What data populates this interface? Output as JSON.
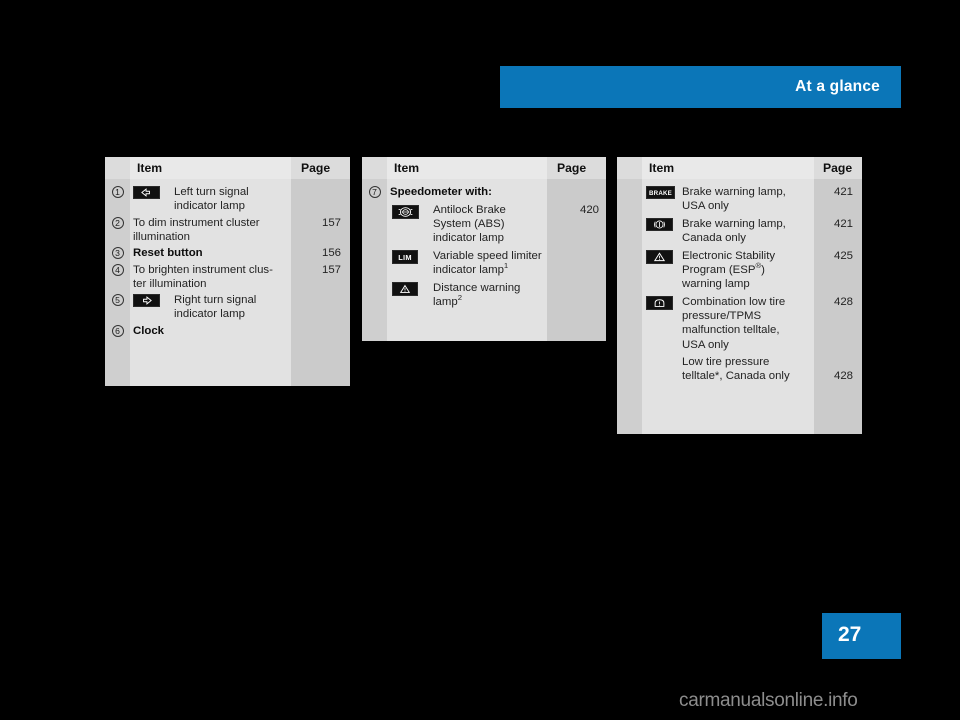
{
  "header": {
    "title": "At a glance",
    "bar_color": "#0b76b8"
  },
  "footer": {
    "page_number": "27",
    "watermark": "carmanualsonline.info"
  },
  "tables": [
    {
      "id": "table-instrument-cluster",
      "columns": {
        "item": "Item",
        "page": "Page"
      },
      "rows": [
        {
          "num": "1",
          "icon": "left-turn-signal-icon",
          "text": "Left turn signal indicator lamp",
          "page": "",
          "bold": false
        },
        {
          "num": "2",
          "icon": "",
          "text": "To dim instrument cluster illumination",
          "page": "157",
          "bold": false
        },
        {
          "num": "3",
          "icon": "",
          "text": "Reset button",
          "page": "156",
          "bold": true
        },
        {
          "num": "4",
          "icon": "",
          "text": "To brighten instrument clus-ter illumination",
          "page": "157",
          "bold": false
        },
        {
          "num": "5",
          "icon": "right-turn-signal-icon",
          "text": "Right turn signal indicator lamp",
          "page": "",
          "bold": false
        },
        {
          "num": "6",
          "icon": "",
          "text": "Clock",
          "page": "",
          "bold": true
        }
      ]
    },
    {
      "id": "table-speedometer",
      "columns": {
        "item": "Item",
        "page": "Page"
      },
      "rows": [
        {
          "num": "7",
          "icon": "",
          "text": "Speedometer with:",
          "page": "",
          "bold": true
        },
        {
          "num": "",
          "icon": "abs-icon",
          "text": "Antilock Brake System (ABS) indicator lamp",
          "page": "420",
          "bold": false
        },
        {
          "num": "",
          "icon": "lim-icon",
          "text": "Variable speed limiter indicator lamp",
          "sup": "1",
          "page": "",
          "bold": false
        },
        {
          "num": "",
          "icon": "distance-warning-icon",
          "text": "Distance warning lamp",
          "sup": "2",
          "page": "",
          "bold": false
        }
      ]
    },
    {
      "id": "table-warning-lamps",
      "columns": {
        "item": "Item",
        "page": "Page"
      },
      "rows": [
        {
          "num": "",
          "icon": "brake-text-icon",
          "text": "Brake warning lamp, USA only",
          "page": "421",
          "bold": false
        },
        {
          "num": "",
          "icon": "brake-circle-icon",
          "text": "Brake warning lamp, Canada only",
          "page": "421",
          "bold": false
        },
        {
          "num": "",
          "icon": "esp-triangle-icon",
          "text": "Electronic Stability Program (ESP®) warning lamp",
          "page": "425",
          "bold": false
        },
        {
          "num": "",
          "icon": "tire-pressure-icon",
          "text": "Combination low tire pressure/TPMS malfunction telltale, USA only",
          "page": "428",
          "bold": false
        },
        {
          "num": "",
          "icon": "",
          "text": "Low tire pressure telltale*, Canada only",
          "page": "428",
          "bold": false
        }
      ]
    }
  ]
}
